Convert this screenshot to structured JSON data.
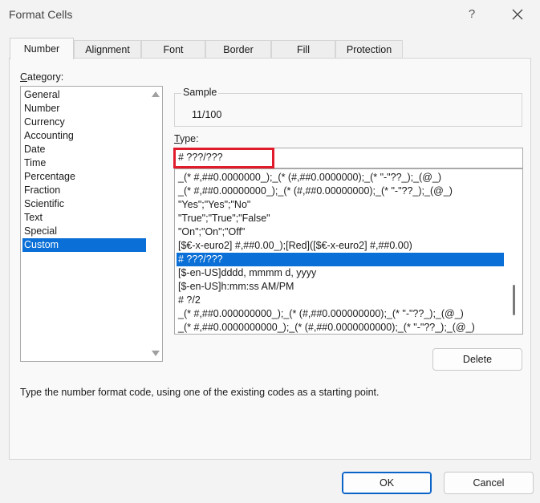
{
  "window": {
    "title": "Format Cells",
    "help_label": "?"
  },
  "tabs": [
    {
      "label": "Number",
      "active": true
    },
    {
      "label": "Alignment"
    },
    {
      "label": "Font"
    },
    {
      "label": "Border"
    },
    {
      "label": "Fill"
    },
    {
      "label": "Protection"
    }
  ],
  "category": {
    "label": "Category:",
    "items": [
      "General",
      "Number",
      "Currency",
      "Accounting",
      "Date",
      "Time",
      "Percentage",
      "Fraction",
      "Scientific",
      "Text",
      "Special",
      "Custom"
    ],
    "selected": "Custom"
  },
  "sample": {
    "label": "Sample",
    "value": "11/100"
  },
  "type": {
    "label": "Type:",
    "value": "# ???/???",
    "list": [
      "_(* #,##0.0000000_);_(* (#,##0.0000000);_(* \"-\"??_);_(@_)",
      "_(* #,##0.00000000_);_(* (#,##0.00000000);_(* \"-\"??_);_(@_)",
      "\"Yes\";\"Yes\";\"No\"",
      "\"True\";\"True\";\"False\"",
      "\"On\";\"On\";\"Off\"",
      "[$€-x-euro2] #,##0.00_);[Red]([$€-x-euro2] #,##0.00)",
      "# ???/???",
      "[$-en-US]dddd, mmmm d, yyyy",
      "[$-en-US]h:mm:ss AM/PM",
      "# ?/2",
      "_(* #,##0.000000000_);_(* (#,##0.000000000);_(* \"-\"??_);_(@_)",
      "_(* #,##0.0000000000_);_(* (#,##0.0000000000);_(* \"-\"??_);_(@_)"
    ],
    "selected": "# ???/???"
  },
  "buttons": {
    "delete": "Delete",
    "ok": "OK",
    "cancel": "Cancel"
  },
  "hint": "Type the number format code, using one of the existing codes as a starting point.",
  "colors": {
    "accent": "#0a6fd6",
    "highlight_box": "#e01b2b"
  }
}
